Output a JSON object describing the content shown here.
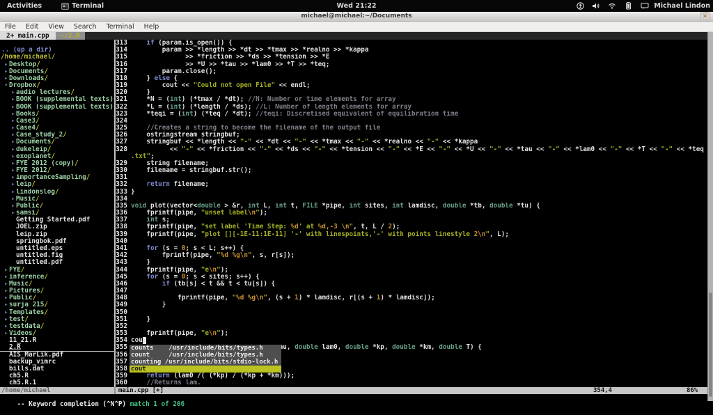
{
  "colors": {
    "keyword": "#7f8bd0",
    "type": "#69a086",
    "string": "#a9b226",
    "special": "#c78f2e",
    "comment": "#7f7f8a",
    "dir_name": "#9ed2a8",
    "dir_slash": "#c6c622",
    "popup_selected_bg": "#b9c21f",
    "match_green": "#46c387"
  },
  "topbar": {
    "activities": "Activities",
    "app": "Terminal",
    "clock": "Wed 21:22",
    "user": "Michael Lindon"
  },
  "titlebar": {
    "title": "michael@michael:~/Documents",
    "close": "✕"
  },
  "menubar": {
    "items": [
      "File",
      "Edit",
      "View",
      "Search",
      "Terminal",
      "Help"
    ]
  },
  "tabline": {
    "tab_active": "2+ main.cpp",
    "tab_other": "~/2.R"
  },
  "tree": {
    "rows": [
      {
        "t": "b",
        "l": 0,
        "name": ""
      },
      {
        "t": "u",
        "l": 0,
        "name": ".. (up a dir)"
      },
      {
        "t": "h",
        "l": 0,
        "name": "/home/michael/"
      },
      {
        "t": "d",
        "l": 0,
        "name": "Desktop"
      },
      {
        "t": "d",
        "l": 0,
        "name": "Documents"
      },
      {
        "t": "d",
        "l": 0,
        "name": "Downloads"
      },
      {
        "t": "o",
        "l": 0,
        "name": "Dropbox"
      },
      {
        "t": "d",
        "l": 1,
        "name": "audio lectures"
      },
      {
        "t": "d",
        "l": 1,
        "name": "BOOK (supplemental texts) ("
      },
      {
        "t": "d",
        "l": 1,
        "name": "BOOK (supplemental texts) ("
      },
      {
        "t": "d",
        "l": 1,
        "name": "Books"
      },
      {
        "t": "d",
        "l": 1,
        "name": "Case3"
      },
      {
        "t": "d",
        "l": 1,
        "name": "Case4"
      },
      {
        "t": "d",
        "l": 1,
        "name": "Case_study_2"
      },
      {
        "t": "d",
        "l": 1,
        "name": "Documents"
      },
      {
        "t": "d",
        "l": 1,
        "name": "dukeleip"
      },
      {
        "t": "d",
        "l": 1,
        "name": "exoplanet"
      },
      {
        "t": "d",
        "l": 1,
        "name": "FYE 2012 (copy)"
      },
      {
        "t": "d",
        "l": 1,
        "name": "FYE 2012"
      },
      {
        "t": "d",
        "l": 1,
        "name": "importanceSampling"
      },
      {
        "t": "d",
        "l": 1,
        "name": "leip"
      },
      {
        "t": "d",
        "l": 1,
        "name": "lindonslog"
      },
      {
        "t": "d",
        "l": 1,
        "name": "Music"
      },
      {
        "t": "d",
        "l": 1,
        "name": "Public"
      },
      {
        "t": "d",
        "l": 1,
        "name": "samsi"
      },
      {
        "t": "f",
        "l": 1,
        "name": "Getting Started.pdf"
      },
      {
        "t": "f",
        "l": 1,
        "name": "JOEL.zip"
      },
      {
        "t": "f",
        "l": 1,
        "name": "leip.zip"
      },
      {
        "t": "f",
        "l": 1,
        "name": "springbok.pdf"
      },
      {
        "t": "f",
        "l": 1,
        "name": "untitled.eps"
      },
      {
        "t": "f",
        "l": 1,
        "name": "untitled.fig"
      },
      {
        "t": "f",
        "l": 1,
        "name": "untitled.pdf"
      },
      {
        "t": "d",
        "l": 0,
        "name": "FYE"
      },
      {
        "t": "d",
        "l": 0,
        "name": "inference"
      },
      {
        "t": "d",
        "l": 0,
        "name": "Music"
      },
      {
        "t": "d",
        "l": 0,
        "name": "Pictures"
      },
      {
        "t": "d",
        "l": 0,
        "name": "Public"
      },
      {
        "t": "d",
        "l": 0,
        "name": "surja 215"
      },
      {
        "t": "d",
        "l": 0,
        "name": "Templates"
      },
      {
        "t": "d",
        "l": 0,
        "name": "test"
      },
      {
        "t": "d",
        "l": 0,
        "name": "testdata"
      },
      {
        "t": "d",
        "l": 0,
        "name": "Videos"
      },
      {
        "t": "f",
        "l": 0,
        "name": "11_21.R"
      },
      {
        "t": "fs",
        "l": 0,
        "name": "2.R"
      },
      {
        "t": "f",
        "l": 0,
        "name": "AIS_MarLik.pdf"
      },
      {
        "t": "f",
        "l": 0,
        "name": "backup_vimrc"
      },
      {
        "t": "f",
        "l": 0,
        "name": "bills.dat"
      },
      {
        "t": "f",
        "l": 0,
        "name": "ch5.R"
      },
      {
        "t": "f",
        "l": 0,
        "name": "ch5.R.1"
      }
    ]
  },
  "editor": {
    "rows": [
      {
        "n": "313",
        "s": [
          [
            "p",
            "    "
          ],
          [
            "k",
            "if"
          ],
          [
            "p",
            " (param.is_open()) {"
          ]
        ]
      },
      {
        "n": "314",
        "s": [
          [
            "p",
            "        param >> *length >> *dt >> *tmax >> *realno >> *kappa"
          ]
        ]
      },
      {
        "n": "315",
        "s": [
          [
            "p",
            "              >> *friction >> *ds >> *tension >> *E"
          ]
        ]
      },
      {
        "n": "316",
        "s": [
          [
            "p",
            "              >> *U >> *tau >> *lam0 >> *T >> *teq;"
          ]
        ]
      },
      {
        "n": "317",
        "s": [
          [
            "p",
            "        param.close();"
          ]
        ]
      },
      {
        "n": "318",
        "s": [
          [
            "p",
            "    } "
          ],
          [
            "k",
            "else"
          ],
          [
            "p",
            " {"
          ]
        ]
      },
      {
        "n": "319",
        "s": [
          [
            "p",
            "        cout << "
          ],
          [
            "s",
            "\"Could not open File\""
          ],
          [
            "p",
            " << endl;"
          ]
        ]
      },
      {
        "n": "320",
        "s": [
          [
            "p",
            "    }"
          ]
        ]
      },
      {
        "n": "321",
        "s": [
          [
            "p",
            "    *N = ("
          ],
          [
            "t",
            "int"
          ],
          [
            "p",
            ") (*tmax / *dt); "
          ],
          [
            "c",
            "//N: Number or time elements for array"
          ]
        ]
      },
      {
        "n": "322",
        "s": [
          [
            "p",
            "    *L = ("
          ],
          [
            "t",
            "int"
          ],
          [
            "p",
            ") (*length / *ds); "
          ],
          [
            "c",
            "//L: Number of length elements for array"
          ]
        ]
      },
      {
        "n": "323",
        "s": [
          [
            "p",
            "    *teqi = ("
          ],
          [
            "t",
            "int"
          ],
          [
            "p",
            ") (*teq / *dt); "
          ],
          [
            "c",
            "//teqi: Discretised equivalent of equilibration time"
          ]
        ]
      },
      {
        "n": "324",
        "s": []
      },
      {
        "n": "325",
        "s": [
          [
            "p",
            "    "
          ],
          [
            "c",
            "//Creates a string to become the filename of the output file"
          ]
        ]
      },
      {
        "n": "326",
        "s": [
          [
            "p",
            "    ostringstream stringbuf;"
          ]
        ]
      },
      {
        "n": "327",
        "s": [
          [
            "p",
            "    stringbuf << *length << "
          ],
          [
            "s",
            "\"-\""
          ],
          [
            "p",
            " << *dt << "
          ],
          [
            "s",
            "\"-\""
          ],
          [
            "p",
            " << *tmax << "
          ],
          [
            "s",
            "\"-\""
          ],
          [
            "p",
            " << *realno << "
          ],
          [
            "s",
            "\"-\""
          ],
          [
            "p",
            " << *kappa"
          ]
        ]
      },
      {
        "n": "328",
        "s": [
          [
            "p",
            "          << "
          ],
          [
            "s",
            "\"-\""
          ],
          [
            "p",
            " << *friction << "
          ],
          [
            "s",
            "\"-\""
          ],
          [
            "p",
            " << *ds << "
          ],
          [
            "s",
            "\"-\""
          ],
          [
            "p",
            " << *tension << "
          ],
          [
            "s",
            "\"-\""
          ],
          [
            "p",
            " << *E << "
          ],
          [
            "s",
            "\"-\""
          ],
          [
            "p",
            " << *U << "
          ],
          [
            "s",
            "\"-\""
          ],
          [
            "p",
            " << *tau << "
          ],
          [
            "s",
            "\"-\""
          ],
          [
            "p",
            " << *lam0 << "
          ],
          [
            "s",
            "\"-\""
          ],
          [
            "p",
            " << *T << "
          ],
          [
            "s",
            "\"-\""
          ],
          [
            "p",
            " << *teq << "
          ],
          [
            "s",
            "\""
          ]
        ]
      },
      {
        "n": "",
        "s": [
          [
            "s",
            ".txt\""
          ],
          [
            "p",
            ";"
          ]
        ]
      },
      {
        "n": "329",
        "s": [
          [
            "p",
            "    string filename;"
          ]
        ]
      },
      {
        "n": "330",
        "s": [
          [
            "p",
            "    filename = stringbuf.str();"
          ]
        ]
      },
      {
        "n": "331",
        "s": []
      },
      {
        "n": "332",
        "s": [
          [
            "p",
            "    "
          ],
          [
            "k",
            "return"
          ],
          [
            "p",
            " filename;"
          ]
        ]
      },
      {
        "n": "333",
        "s": [
          [
            "p",
            "}"
          ]
        ]
      },
      {
        "n": "334",
        "s": []
      },
      {
        "n": "335",
        "s": [
          [
            "t",
            "void"
          ],
          [
            "p",
            " plot(vector<"
          ],
          [
            "t",
            "double"
          ],
          [
            "p",
            " > &r, "
          ],
          [
            "t",
            "int"
          ],
          [
            "p",
            " L, "
          ],
          [
            "t",
            "int"
          ],
          [
            "p",
            " t, "
          ],
          [
            "t",
            "FILE"
          ],
          [
            "p",
            " *pipe, "
          ],
          [
            "t",
            "int"
          ],
          [
            "p",
            " sites, "
          ],
          [
            "t",
            "int"
          ],
          [
            "p",
            " lamdisc, "
          ],
          [
            "t",
            "double"
          ],
          [
            "p",
            " *tb, "
          ],
          [
            "t",
            "double"
          ],
          [
            "p",
            " *tu) {"
          ]
        ]
      },
      {
        "n": "336",
        "s": [
          [
            "p",
            "    fprintf(pipe, "
          ],
          [
            "s",
            "\"unset label"
          ],
          [
            "x",
            "\\n"
          ],
          [
            "s",
            "\""
          ],
          [
            "p",
            ");"
          ]
        ]
      },
      {
        "n": "337",
        "s": [
          [
            "p",
            "    "
          ],
          [
            "t",
            "int"
          ],
          [
            "p",
            " s;"
          ]
        ]
      },
      {
        "n": "338",
        "s": [
          [
            "p",
            "    fprintf(pipe, "
          ],
          [
            "s",
            "\"set label 'Time Step: "
          ],
          [
            "x",
            "%d"
          ],
          [
            "s",
            "' at "
          ],
          [
            "x",
            "%d"
          ],
          [
            "s",
            ","
          ],
          [
            "x",
            "-3"
          ],
          [
            "s",
            " "
          ],
          [
            "x",
            "\\n"
          ],
          [
            "s",
            "\""
          ],
          [
            "p",
            ", t, L / "
          ],
          [
            "n",
            "2"
          ],
          [
            "p",
            ");"
          ]
        ]
      },
      {
        "n": "339",
        "s": [
          [
            "p",
            "    fprintf(pipe, "
          ],
          [
            "s",
            "\"plot [][-1E-11:1E-11] '-' with linespoints,'-' with points linestyle "
          ],
          [
            "x",
            "2"
          ],
          [
            "x",
            "\\n"
          ],
          [
            "s",
            "\""
          ],
          [
            "p",
            ", L);"
          ]
        ]
      },
      {
        "n": "340",
        "s": []
      },
      {
        "n": "341",
        "s": [
          [
            "p",
            "    "
          ],
          [
            "k",
            "for"
          ],
          [
            "p",
            " (s = "
          ],
          [
            "n",
            "0"
          ],
          [
            "p",
            "; s < L; s++) {"
          ]
        ]
      },
      {
        "n": "342",
        "s": [
          [
            "p",
            "        fprintf(pipe, "
          ],
          [
            "s",
            "\""
          ],
          [
            "x",
            "%d"
          ],
          [
            "s",
            " "
          ],
          [
            "x",
            "%g"
          ],
          [
            "x",
            "\\n"
          ],
          [
            "s",
            "\""
          ],
          [
            "p",
            ", s, r[s]);"
          ]
        ]
      },
      {
        "n": "343",
        "s": [
          [
            "p",
            "    }"
          ]
        ]
      },
      {
        "n": "344",
        "s": [
          [
            "p",
            "    fprintf(pipe, "
          ],
          [
            "s",
            "\"e"
          ],
          [
            "x",
            "\\n"
          ],
          [
            "s",
            "\""
          ],
          [
            "p",
            ");"
          ]
        ]
      },
      {
        "n": "345",
        "s": [
          [
            "p",
            "    "
          ],
          [
            "k",
            "for"
          ],
          [
            "p",
            " (s = "
          ],
          [
            "n",
            "0"
          ],
          [
            "p",
            "; s < sites; s++) {"
          ]
        ]
      },
      {
        "n": "346",
        "s": [
          [
            "p",
            "        "
          ],
          [
            "k",
            "if"
          ],
          [
            "p",
            " (tb[s] < t && t < tu[s]) {"
          ]
        ]
      },
      {
        "n": "347",
        "s": []
      },
      {
        "n": "348",
        "s": [
          [
            "p",
            "            fprintf(pipe, "
          ],
          [
            "s",
            "\""
          ],
          [
            "x",
            "%d"
          ],
          [
            "s",
            " "
          ],
          [
            "x",
            "%g"
          ],
          [
            "x",
            "\\n"
          ],
          [
            "s",
            "\""
          ],
          [
            "p",
            ", (s + "
          ],
          [
            "n",
            "1"
          ],
          [
            "p",
            ") * lamdisc, r[(s + "
          ],
          [
            "n",
            "1"
          ],
          [
            "p",
            ") * lamdisc]);"
          ]
        ]
      },
      {
        "n": "349",
        "s": [
          [
            "p",
            "        }"
          ]
        ]
      },
      {
        "n": "350",
        "s": []
      },
      {
        "n": "351",
        "s": [
          [
            "p",
            "    }"
          ]
        ]
      },
      {
        "n": "352",
        "s": []
      },
      {
        "n": "353",
        "s": [
          [
            "p",
            "    fprintf(pipe, "
          ],
          [
            "s",
            "\"e"
          ],
          [
            "x",
            "\\n"
          ],
          [
            "s",
            "\""
          ],
          [
            "p",
            ");"
          ]
        ]
      },
      {
        "n": "354",
        "s": [
          [
            "p",
            "cou"
          ],
          [
            "cur",
            " "
          ]
        ]
      },
      {
        "n": "355",
        "s": [
          [
            "p",
            "                                      au, "
          ],
          [
            "t",
            "double"
          ],
          [
            "p",
            " lam0, "
          ],
          [
            "t",
            "double"
          ],
          [
            "p",
            " *kp, "
          ],
          [
            "t",
            "double"
          ],
          [
            "p",
            " *km, "
          ],
          [
            "t",
            "double"
          ],
          [
            "p",
            " T) {"
          ]
        ]
      },
      {
        "n": "356",
        "s": []
      },
      {
        "n": "357",
        "s": []
      },
      {
        "n": "358",
        "s": []
      },
      {
        "n": "359",
        "s": [
          [
            "p",
            "    "
          ],
          [
            "k",
            "return"
          ],
          [
            "p",
            " (lam0 /( (*kp) / (*kp + *km)));"
          ]
        ]
      },
      {
        "n": "360",
        "s": [
          [
            "p",
            "    "
          ],
          [
            "c",
            "//Returns lam."
          ]
        ]
      }
    ]
  },
  "popup": {
    "items": [
      {
        "text": "counts    /usr/include/bits/types.h",
        "selected": false
      },
      {
        "text": "count     /usr/include/bits/types.h",
        "selected": false
      },
      {
        "text": "counting /usr/include/bits/stdio-lock.h",
        "selected": false
      },
      {
        "text": "cout",
        "selected": true
      }
    ]
  },
  "statusbar": {
    "left": "/home/michael",
    "file": "main.cpp [+]",
    "position": "354,4",
    "percent": "86%"
  },
  "cmdline": {
    "mode": "-- Keyword completion (^N^P) ",
    "match": "match 1 of 206"
  }
}
